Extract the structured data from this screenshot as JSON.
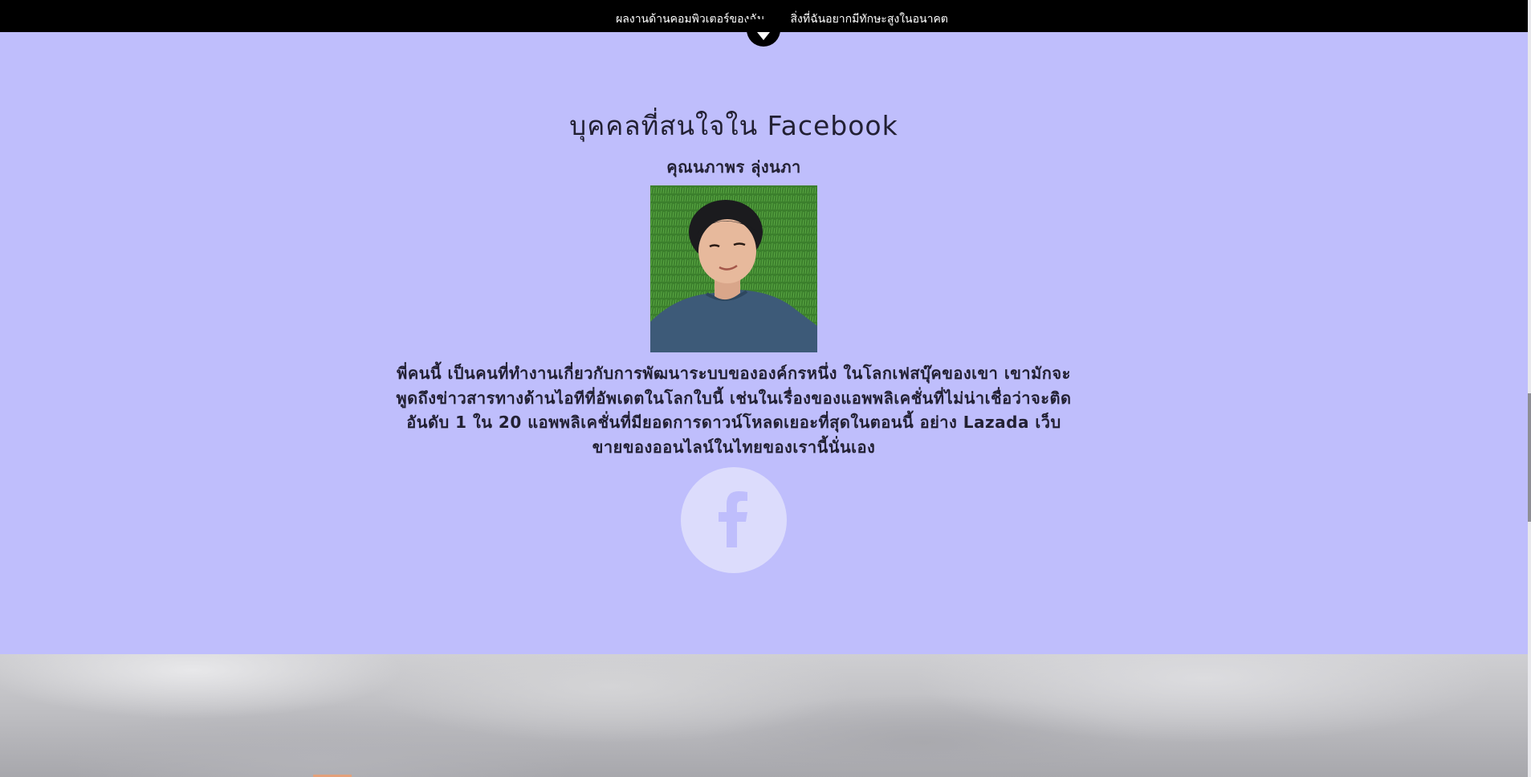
{
  "nav": {
    "items": [
      {
        "label": "ผลงานด้านคอมพิวเตอร์ของฉัน"
      },
      {
        "label": "สิ่งที่ฉันอยากมีทักษะสูงในอนาคต"
      }
    ]
  },
  "section": {
    "title": "บุคคลที่สนใจใน Facebook",
    "person_name": "คุณนภาพร ลุ่งนภา",
    "description": "พี่คนนี้ เป็นคนที่ทำงานเกี่ยวกับการพัฒนาระบบขององค์กรหนึ่ง ในโลกเฟสบุ๊คของเขา เขามักจะพูดถึงข่าวสารทางด้านไอทีที่อัพเดตในโลกใบนี้ เช่นในเรื่องของแอพพลิเคชั่นที่ไม่น่าเชื่อว่าจะติดอันดับ 1 ใน 20 แอพพลิเคชั่นที่มียอดการดาวน์โหลดเยอะที่สุดในตอนนี้ อย่าง Lazada เว็บขายของออนไลน์ในไทยของเรานี้นั่นเอง",
    "photo_icon": "profile-photo",
    "social_icon": "facebook-icon"
  },
  "colors": {
    "nav_background": "#000000",
    "section_background": "#bfbefc",
    "text": "#222033",
    "facebook_circle": "#dcdcfc",
    "facebook_glyph": "#bfbefc"
  }
}
